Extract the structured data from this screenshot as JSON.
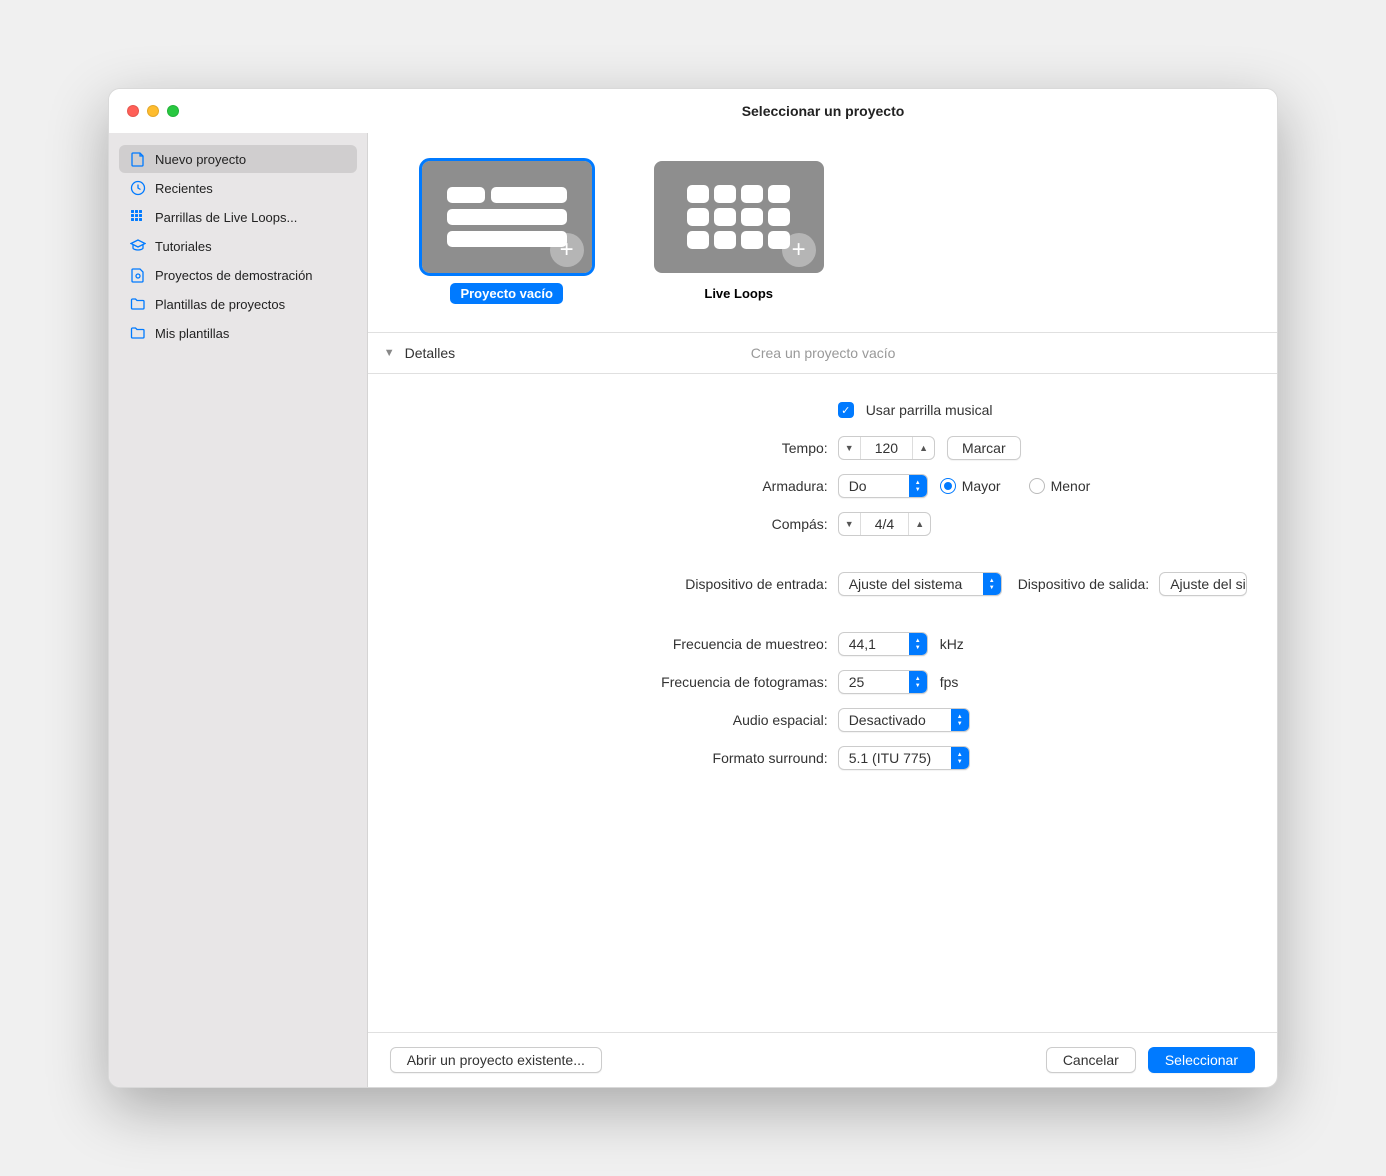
{
  "window": {
    "title": "Seleccionar un proyecto"
  },
  "sidebar": {
    "items": [
      {
        "icon": "document-icon",
        "label": "Nuevo proyecto",
        "selected": true
      },
      {
        "icon": "clock-icon",
        "label": "Recientes",
        "selected": false
      },
      {
        "icon": "grid-icon",
        "label": "Parrillas de Live Loops...",
        "selected": false
      },
      {
        "icon": "graduation-cap-icon",
        "label": "Tutoriales",
        "selected": false
      },
      {
        "icon": "document-badge-icon",
        "label": "Proyectos de demostración",
        "selected": false
      },
      {
        "icon": "folder-icon",
        "label": "Plantillas de proyectos",
        "selected": false
      },
      {
        "icon": "folder-icon",
        "label": "Mis plantillas",
        "selected": false
      }
    ]
  },
  "templates": [
    {
      "label": "Proyecto vacío",
      "selected": true,
      "kind": "tracks"
    },
    {
      "label": "Live Loops",
      "selected": false,
      "kind": "grid"
    }
  ],
  "details": {
    "heading": "Detalles",
    "subtitle": "Crea un proyecto vacío",
    "use_music_grid_label": "Usar parrilla musical",
    "use_music_grid_checked": true,
    "tempo_label": "Tempo:",
    "tempo_value": "120",
    "tempo_tap_button": "Marcar",
    "key_label": "Armadura:",
    "key_value": "Do",
    "key_major_label": "Mayor",
    "key_minor_label": "Menor",
    "key_mode": "major",
    "time_sig_label": "Compás:",
    "time_sig_value": "4/4",
    "input_device_label": "Dispositivo de entrada:",
    "input_device_value": "Ajuste del sistema",
    "output_device_label": "Dispositivo de salida:",
    "output_device_value": "Ajuste del sistema",
    "sample_rate_label": "Frecuencia de muestreo:",
    "sample_rate_value": "44,1",
    "sample_rate_unit": "kHz",
    "frame_rate_label": "Frecuencia de fotogramas:",
    "frame_rate_value": "25",
    "frame_rate_unit": "fps",
    "spatial_audio_label": "Audio espacial:",
    "spatial_audio_value": "Desactivado",
    "surround_label": "Formato surround:",
    "surround_value": "5.1 (ITU 775)"
  },
  "footer": {
    "open_existing": "Abrir un proyecto existente...",
    "cancel": "Cancelar",
    "select": "Seleccionar"
  }
}
